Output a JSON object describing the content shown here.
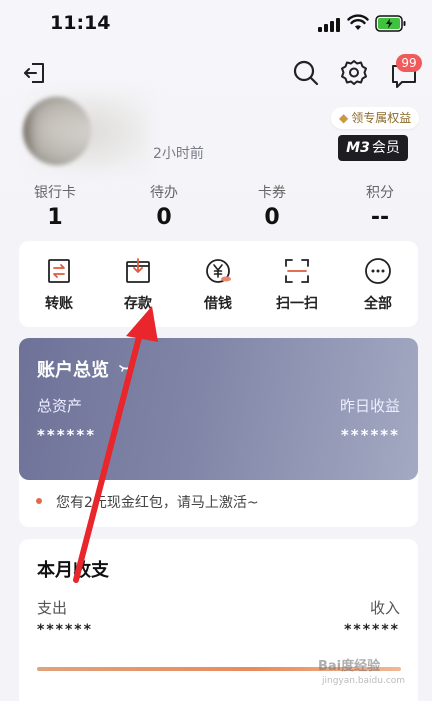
{
  "status_bar": {
    "time": "11:14"
  },
  "nav": {
    "message_badge": "99"
  },
  "profile": {
    "time_ago": "2小时前",
    "vip_chip": "领专属权益",
    "member_level": "M3",
    "member_suffix": "会员"
  },
  "stats": [
    {
      "label": "银行卡",
      "value": "1"
    },
    {
      "label": "待办",
      "value": "0"
    },
    {
      "label": "卡券",
      "value": "0"
    },
    {
      "label": "积分",
      "value": "--"
    }
  ],
  "quick_actions": [
    {
      "label": "转账",
      "icon": "transfer-icon"
    },
    {
      "label": "存款",
      "icon": "deposit-icon"
    },
    {
      "label": "借钱",
      "icon": "yuan-loan-icon"
    },
    {
      "label": "扫一扫",
      "icon": "scan-icon"
    },
    {
      "label": "全部",
      "icon": "more-icon"
    }
  ],
  "overview": {
    "title": "账户总览",
    "total_assets_label": "总资产",
    "total_assets_value": "******",
    "yesterday_income_label": "昨日收益",
    "yesterday_income_value": "******"
  },
  "tip": {
    "text": "您有2元现金红包，请马上激活~"
  },
  "monthly": {
    "title": "本月收支",
    "expense_label": "支出",
    "expense_value": "******",
    "income_label": "收入",
    "income_value": "******"
  },
  "watermark": {
    "text": "Bai度经验",
    "sub": "jingyan.baidu.com"
  },
  "colors": {
    "accent_red": "#f05a5a",
    "overview_gradient_start": "#6f7298",
    "overview_gradient_end": "#a3a9c2",
    "annotation_arrow": "#e8262b"
  }
}
